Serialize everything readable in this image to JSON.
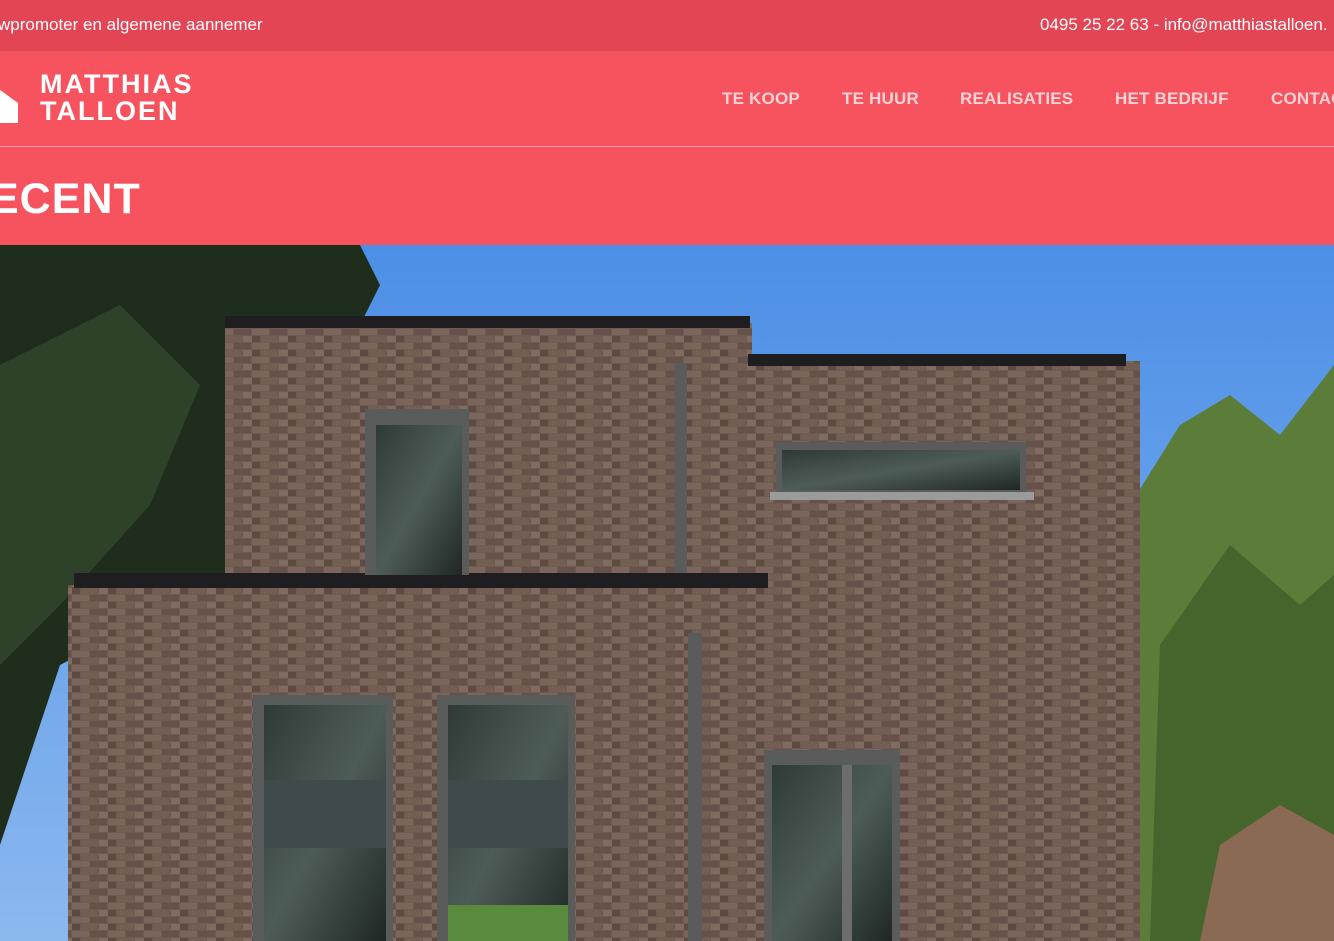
{
  "topbar": {
    "tagline": "wpromoter en algemene aannemer",
    "contact": "0495 25 22 63 - info@matthiastalloen."
  },
  "logo": {
    "line1": "MATTHIAS",
    "line2": "TALLOEN",
    "icon": "house-icon"
  },
  "nav": {
    "items": [
      {
        "label": "TE KOOP"
      },
      {
        "label": "TE HUUR"
      },
      {
        "label": "REALISATIES"
      },
      {
        "label": "HET BEDRIJF"
      },
      {
        "label": "CONTAC"
      }
    ]
  },
  "page": {
    "title": "ECENT"
  },
  "colors": {
    "brand": "#f6535f",
    "topbar": "#e34554",
    "nav_text": "#fbd3d6"
  },
  "hero": {
    "image": "hero-photo-modern-brick-house"
  }
}
